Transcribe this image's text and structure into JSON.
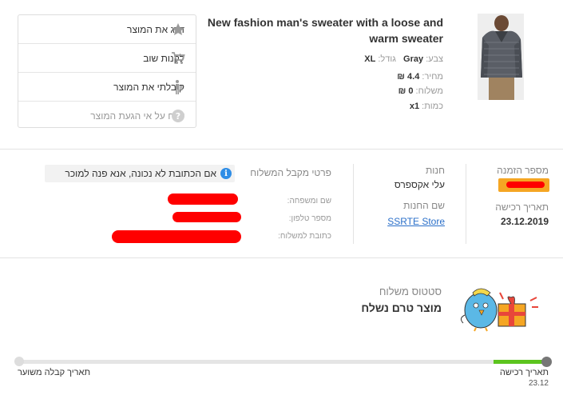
{
  "product": {
    "title": "New fashion man's sweater with a loose and warm sweater",
    "color_label": "צבע:",
    "color_value": "Gray",
    "size_label": "גודל:",
    "size_value": "XL",
    "price_label": "מחיר:",
    "price_value": "4.4 ₪",
    "shipping_label": "משלוח:",
    "shipping_value": "0 ₪",
    "qty_label": "כמות:",
    "qty_value": "x1"
  },
  "actions": {
    "rate": "דרג את המוצר",
    "buy_again": "לקנות שוב",
    "received": "קיבלתי את המוצר",
    "report": "דווח על אי הגעת המוצר"
  },
  "order": {
    "order_number_label": "מספר הזמנה",
    "purchase_date_label": "תאריך רכישה",
    "purchase_date_value": "23.12.2019",
    "store_label": "חנות",
    "store_value": "עלי אקספרס",
    "store_name_label": "שם החנות",
    "store_name_value": "SSRTE Store",
    "recipient_title": "פרטי מקבל המשלוח",
    "address_notice": "אם הכתובת לא נכונה, אנא פנה למוכר",
    "name_label": "שם ומשפחה:",
    "phone_label": "מספר טלפון:",
    "address_label": "כתובת למשלוח:"
  },
  "shipping": {
    "status_label": "סטטוס משלוח",
    "status_value": "מוצר טרם נשלח"
  },
  "progress": {
    "start_label": "תאריך רכישה",
    "start_date": "23.12",
    "end_label": "תאריך קבלה משוער",
    "completed_fraction": 0.1
  },
  "colors": {
    "accent_green": "#5cc41e",
    "link_blue": "#2a6fc9",
    "info_blue": "#2e8de6",
    "order_badge": "#f5a623"
  }
}
